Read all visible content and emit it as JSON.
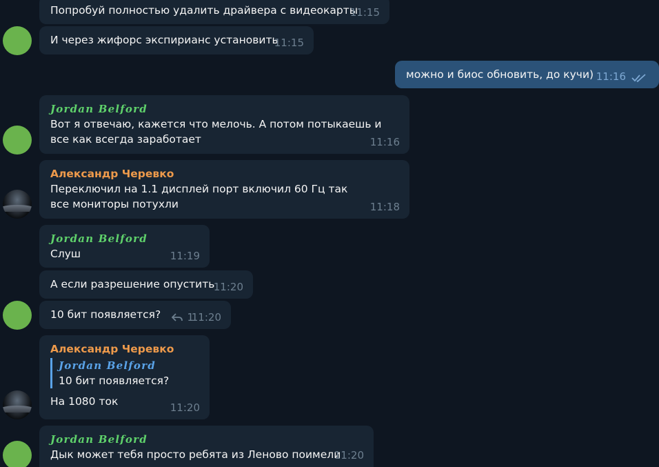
{
  "messages": [
    {
      "text": "Попробуй полностью удалить драйвера с видеокарты",
      "time": "11:15"
    },
    {
      "text": "И через жифорс экспирианс установить",
      "time": "11:15"
    },
    {
      "text": "можно и биос обновить, до кучи)",
      "time": "11:16"
    },
    {
      "sender": "Jordan Belford",
      "text": "Вот я отвечаю, кажется что мелочь. А потом потыкаешь и все как всегда заработает",
      "time": "11:16"
    },
    {
      "sender": "Александр Черевко",
      "text": "Переключил на 1.1 дисплей порт включил 60 Гц так все мониторы потухли",
      "time": "11:18"
    },
    {
      "sender": "Jordan Belford",
      "text": "Слуш",
      "time": "11:19"
    },
    {
      "text": "А если разрешение опустить",
      "time": "11:20"
    },
    {
      "text": "10 бит появляется?",
      "time": "11:20",
      "replies": "1"
    },
    {
      "sender": "Александр Черевко",
      "quote_sender": "Jordan Belford",
      "quote_text": "10 бит появляется?",
      "text": "На 1080 ток",
      "time": "11:20"
    },
    {
      "sender": "Jordan Belford",
      "text": "Дык может тебя просто ребята из Леново поимели",
      "time": "11:20"
    }
  ],
  "colors": {
    "background": "#0e1621",
    "incoming_bubble": "#182533",
    "outgoing_bubble": "#2b5278",
    "jordan_name": "#5fd16b",
    "alex_name": "#ee9a4b",
    "quote_accent": "#5aa3e8"
  },
  "icons": {
    "read_receipt": "double-check-icon",
    "reply": "reply-arrow-icon"
  }
}
